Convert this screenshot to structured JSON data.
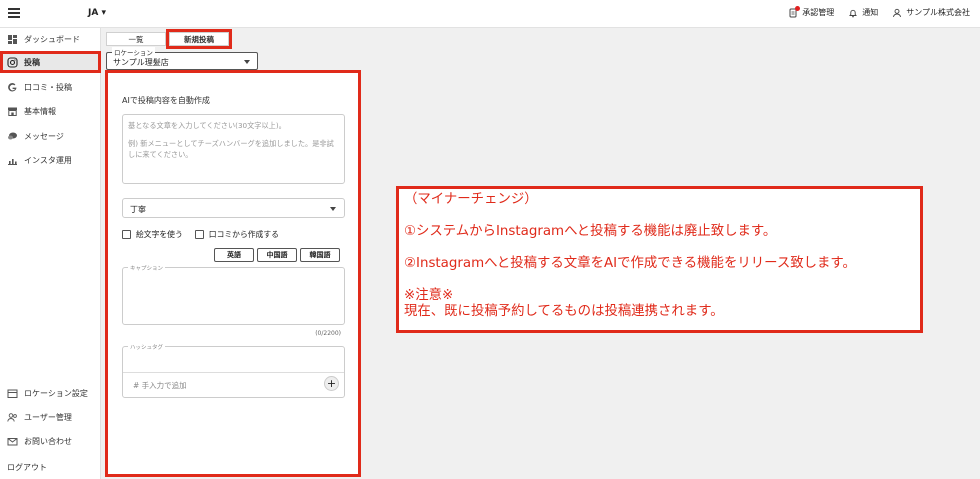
{
  "header": {
    "language": "JA",
    "actions": [
      {
        "label": "承認管理",
        "icon": "approval-bell-icon"
      },
      {
        "label": "通知",
        "icon": "bell-icon"
      },
      {
        "label": "サンプル株式会社",
        "icon": "user-icon"
      }
    ]
  },
  "sidebar": {
    "items": [
      {
        "label": "ダッシュボード",
        "icon": "dashboard-icon"
      },
      {
        "label": "投稿",
        "icon": "instagram-icon"
      },
      {
        "label": "口コミ・投稿",
        "icon": "google-icon"
      },
      {
        "label": "基本情報",
        "icon": "store-icon"
      },
      {
        "label": "メッセージ",
        "icon": "chat-icon"
      },
      {
        "label": "インスタ運用",
        "icon": "analytics-icon"
      }
    ],
    "bottom_items": [
      {
        "label": "ロケーション設定",
        "icon": "location-icon"
      },
      {
        "label": "ユーザー管理",
        "icon": "users-icon"
      },
      {
        "label": "お問い合わせ",
        "icon": "mail-icon"
      },
      {
        "label": "ログアウト",
        "icon": ""
      }
    ]
  },
  "tabs": [
    {
      "label": "一覧"
    },
    {
      "label": "新規投稿"
    }
  ],
  "location": {
    "label": "ロケーション",
    "value": "サンプル理髪店"
  },
  "form": {
    "ai_title": "AIで投稿内容を自動作成",
    "base_text_placeholder": "基となる文章を入力してください(30文字以上)。",
    "base_text_example": "例) 新メニューとしてチーズハンバーグを追加しました。是非試しに来てください。",
    "tone_value": "丁寧",
    "checkbox_emoji": "絵文字を使う",
    "checkbox_review": "口コミから作成する",
    "lang_buttons": [
      "英語",
      "中国語",
      "韓国語"
    ],
    "caption_label": "キャプション",
    "char_count": "(0/2200)",
    "hashtag_label": "ハッシュタグ",
    "hashtag_placeholder": "# 手入力で追加",
    "add_label": "+"
  },
  "notice": {
    "title": "（マイナーチェンジ）",
    "line1": "①システムからInstagramへと投稿する機能は廃止致します。",
    "line2": "②Instagramへと投稿する文章をAIで作成できる機能をリリース致します。",
    "note_title": "※注意※",
    "note_body": "現在、既に投稿予約してるものは投稿連携されます。"
  },
  "colors": {
    "highlight": "#e02a1a"
  }
}
